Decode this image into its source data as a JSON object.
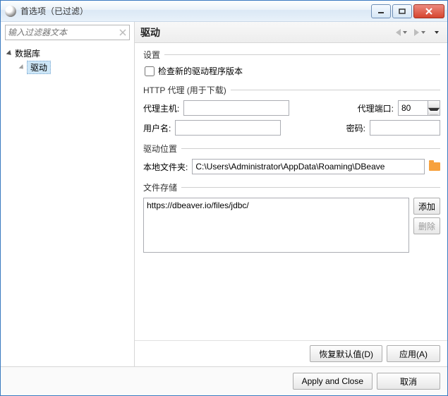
{
  "window": {
    "title": "首选项（已过滤）"
  },
  "filter": {
    "placeholder": "输入过滤器文本"
  },
  "tree": {
    "root": {
      "label": "数据库"
    },
    "selected": {
      "label": "驱动"
    }
  },
  "header": {
    "title": "驱动"
  },
  "groups": {
    "settings": {
      "caption": "设置",
      "check_new_versions": "检查新的驱动程序版本"
    },
    "proxy": {
      "caption": "HTTP 代理 (用于下载)",
      "host_label": "代理主机:",
      "host_value": "",
      "port_label": "代理端口:",
      "port_value": "80",
      "user_label": "用户名:",
      "user_value": "",
      "pass_label": "密码:",
      "pass_value": ""
    },
    "location": {
      "caption": "驱动位置",
      "folder_label": "本地文件夹:",
      "folder_value": "C:\\Users\\Administrator\\AppData\\Roaming\\DBeave"
    },
    "storage": {
      "caption": "文件存储",
      "items": [
        "https://dbeaver.io/files/jdbc/"
      ],
      "add": "添加",
      "remove": "删除"
    }
  },
  "footer": {
    "restore": "恢复默认值(D)",
    "apply": "应用(A)",
    "apply_close": "Apply and Close",
    "cancel": "取消"
  }
}
